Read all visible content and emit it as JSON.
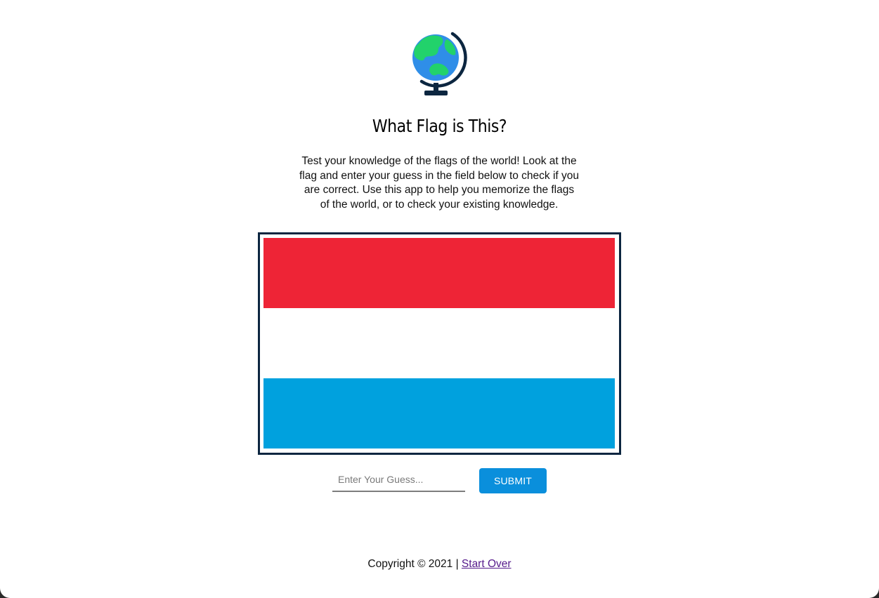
{
  "header": {
    "logo_icon": "globe-icon",
    "title": "What Flag is This?",
    "intro": "Test your knowledge of the flags of the world! Look at the flag and enter your guess in the field below to check if you are correct. Use this app to help you memorize the flags of the world, or to check your existing knowledge."
  },
  "flag": {
    "stripes": [
      {
        "color": "#ee2436"
      },
      {
        "color": "#ffffff"
      },
      {
        "color": "#00a1de"
      }
    ],
    "frame_color": "#0c2640"
  },
  "form": {
    "guess_placeholder": "Enter Your Guess...",
    "guess_value": "",
    "submit_label": "SUBMIT",
    "submit_color": "#0a8fdc"
  },
  "footer": {
    "copyright": "Copyright © 2021 |",
    "start_over_label": "Start Over"
  }
}
